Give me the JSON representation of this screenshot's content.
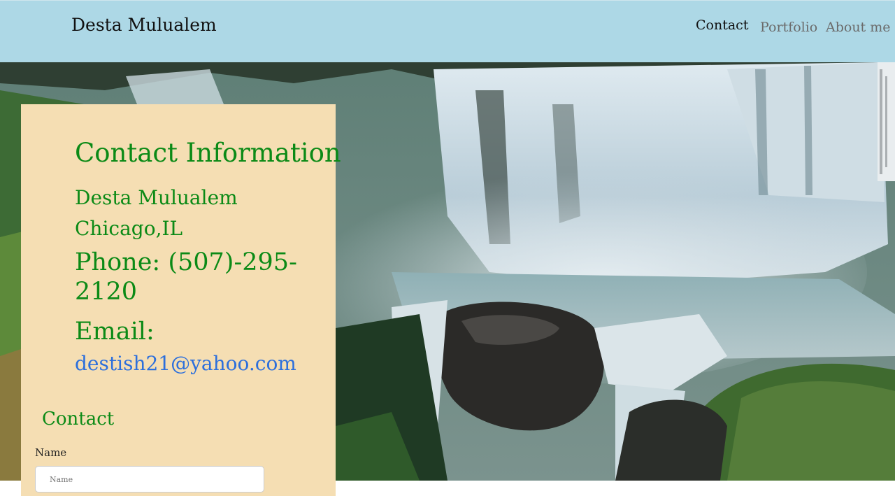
{
  "nav": {
    "brand": "Desta Mulualem",
    "links": [
      {
        "label": "Contact",
        "active": true
      },
      {
        "label": "Portfolio",
        "active": false
      },
      {
        "label": "About me",
        "active": false
      }
    ]
  },
  "contact_info": {
    "heading": "Contact Information",
    "name": "Desta Mulualem",
    "location": "Chicago,IL",
    "phone": "Phone: (507)-295-2120",
    "email_label": "Email:",
    "email": "destish21@yahoo.com"
  },
  "contact_form": {
    "heading": "Contact",
    "name_label": "Name",
    "name_placeholder": "Name"
  },
  "colors": {
    "navbar": "#add8e6",
    "panel": "#f5deb3",
    "heading_green": "#0b8a16",
    "link_blue": "#2c6fdc"
  }
}
